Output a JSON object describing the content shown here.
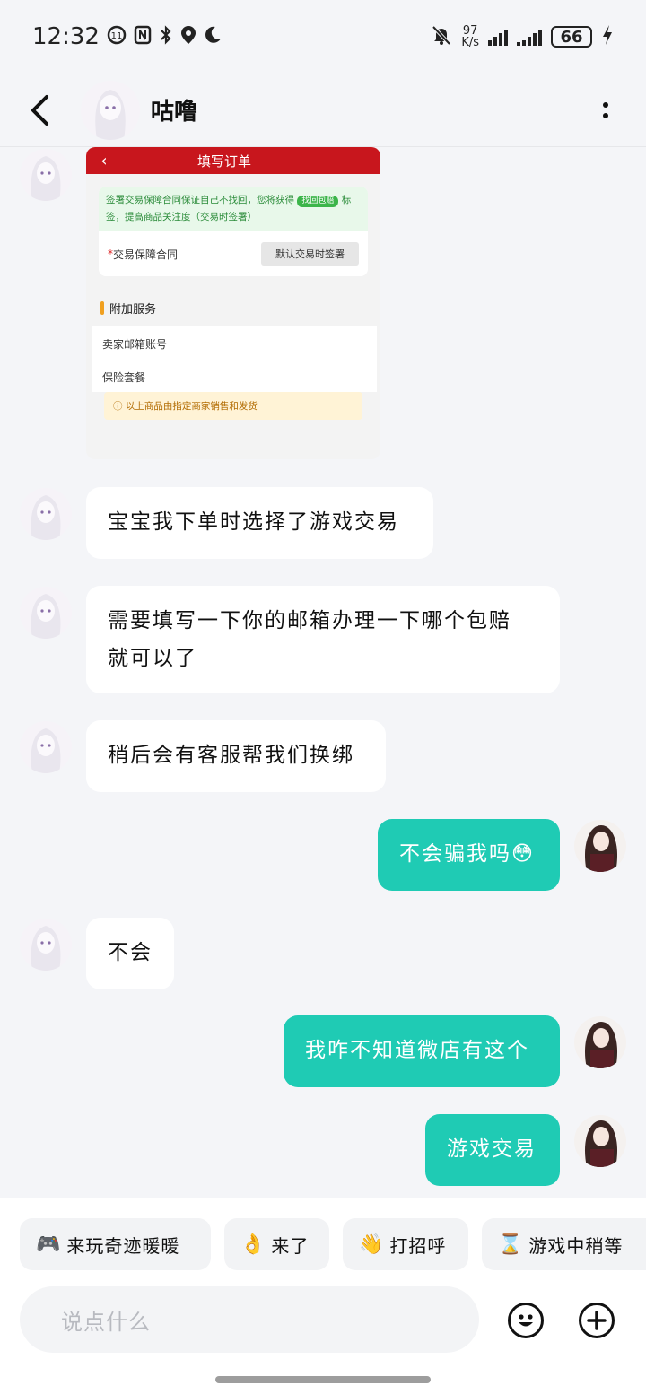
{
  "status_bar": {
    "time": "12:32",
    "left_icons": [
      "app-badge-icon",
      "nfc-icon",
      "bluetooth-icon",
      "location-icon",
      "moon-icon"
    ],
    "net_speed_value": "97",
    "net_speed_unit": "K/s",
    "battery": "66"
  },
  "header": {
    "contact_name": "咕噜"
  },
  "messages": {
    "img_title": "填写订单",
    "img_green_text_1": "签署交易保障合同保证自己不找回，您将获得",
    "img_green_tag": "找回包赔",
    "img_green_text_2": "标签，提高商品关注度（交易时签署）",
    "img_contract_label": "交易保障合同",
    "img_contract_button": "默认交易时签署",
    "img_section_title": "附加服务",
    "img_field_email": "卖家邮箱账号",
    "img_field_insurance": "保险套餐",
    "img_notice": "以上商品由指定商家销售和发货",
    "m1": "宝宝我下单时选择了游戏交易",
    "m2_line1": "需要填写一下你的邮箱办理一下哪个包赔",
    "m2_line2": "就可以了",
    "m3": "稍后会有客服帮我们换绑",
    "m4": "不会骗我吗",
    "m4_emoji": "😳",
    "m5": "不会",
    "m6": "我咋不知道微店有这个",
    "m7": "游戏交易"
  },
  "quick_replies": [
    {
      "emoji": "🎮",
      "label": "来玩奇迹暖暖"
    },
    {
      "emoji": "👌",
      "label": "来了"
    },
    {
      "emoji": "👋",
      "label": "打招呼"
    },
    {
      "emoji": "⌛",
      "label": "游戏中稍等"
    }
  ],
  "input": {
    "placeholder": "说点什么"
  },
  "colors": {
    "sent_bubble": "#1fcbb4",
    "received_bubble": "#ffffff",
    "background": "#f4f5f8"
  }
}
